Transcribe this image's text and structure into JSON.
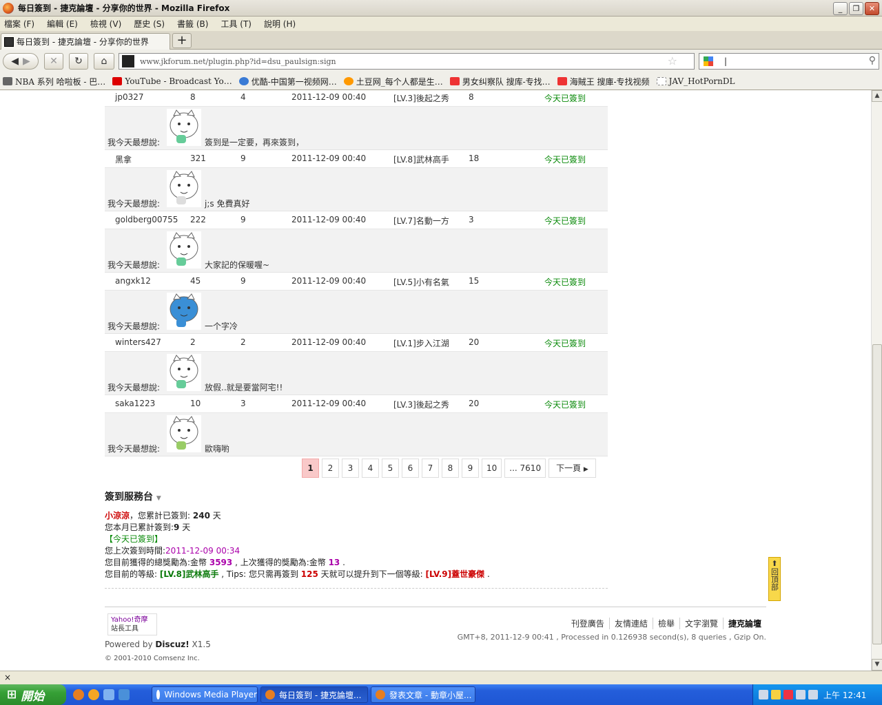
{
  "window": {
    "title": "每日簽到 - 捷克論壇 - 分享你的世界 - Mozilla Firefox"
  },
  "menu": [
    "檔案 (F)",
    "編輯 (E)",
    "檢視 (V)",
    "歷史 (S)",
    "書籤 (B)",
    "工具 (T)",
    "說明 (H)"
  ],
  "tab": {
    "label": "每日簽到 - 捷克論壇 - 分享你的世界",
    "new_tab": "+"
  },
  "nav": {
    "url": "www.jkforum.net/plugin.php?id=dsu_paulsign:sign",
    "search_value": "|"
  },
  "bookmarks": [
    "NBA 系列 哈啦板 - 巴…",
    "YouTube - Broadcast Yo…",
    "优酷-中国第一视频网…",
    "土豆网_每个人都是生…",
    "男女纠察队 搜库-专找…",
    "海賊王 搜庫-专找视频",
    "JAV_HotPornDL"
  ],
  "records": [
    {
      "user": "jp0327",
      "total": "8",
      "month": "4",
      "time": "2011-12-09 00:40",
      "level": "[LV.3]後起之秀",
      "reward": "8",
      "status": "今天已簽到",
      "mood_label": "我今天最想說:",
      "mood": "簽到是一定要，再來簽到，"
    },
    {
      "user": "黑拿",
      "total": "321",
      "month": "9",
      "time": "2011-12-09 00:40",
      "level": "[LV.8]武林高手",
      "reward": "18",
      "status": "今天已簽到",
      "mood_label": "我今天最想說:",
      "mood": "j;s 免費真好"
    },
    {
      "user": "goldberg00755",
      "total": "222",
      "month": "9",
      "time": "2011-12-09 00:40",
      "level": "[LV.7]名動一方",
      "reward": "3",
      "status": "今天已簽到",
      "mood_label": "我今天最想說:",
      "mood": "大家記的保暖喔~"
    },
    {
      "user": "angxk12",
      "total": "45",
      "month": "9",
      "time": "2011-12-09 00:40",
      "level": "[LV.5]小有名氣",
      "reward": "15",
      "status": "今天已簽到",
      "mood_label": "我今天最想說:",
      "mood": "一个字冷"
    },
    {
      "user": "winters427",
      "total": "2",
      "month": "2",
      "time": "2011-12-09 00:40",
      "level": "[LV.1]步入江湖",
      "reward": "20",
      "status": "今天已簽到",
      "mood_label": "我今天最想說:",
      "mood": "放假..就是要當阿宅!!"
    },
    {
      "user": "saka1223",
      "total": "10",
      "month": "3",
      "time": "2011-12-09 00:40",
      "level": "[LV.3]後起之秀",
      "reward": "20",
      "status": "今天已簽到",
      "mood_label": "我今天最想說:",
      "mood": "歐嗨喲"
    }
  ],
  "pager": {
    "pages": [
      "1",
      "2",
      "3",
      "4",
      "5",
      "6",
      "7",
      "8",
      "9",
      "10",
      "... 7610"
    ],
    "current": "1",
    "next": "下一頁"
  },
  "service": {
    "title": "簽到服務台",
    "user": "小涼涼",
    "line1_a": "，您累計已簽到: ",
    "total_days": "240",
    "days_unit": " 天",
    "line2_a": "您本月已累計簽到:",
    "month_days": "9",
    "line3": "【今天已簽到】",
    "line4_a": "您上次簽到時間:",
    "last_time": "2011-12-09 00:34",
    "line5_a": "您目前獲得的總獎勵為:金幣 ",
    "total_reward": "3593",
    "line5_b": " , 上次獲得的獎勵為:金幣 ",
    "last_reward": "13",
    "line5_c": " .",
    "line6_a": "您目前的等級: ",
    "cur_level": "[LV.8]武林高手",
    "line6_b": " , Tips: 您只需再簽到 ",
    "days_needed": "125",
    "line6_c": " 天就可以提升到下一個等級: ",
    "next_level": "[LV.9]蓋世豪傑",
    "line6_d": " ."
  },
  "footer": {
    "yahoo_a": "Yahoo!奇摩",
    "yahoo_b": "站長工具",
    "powered_a": "Powered by ",
    "powered_b": "Discuz!",
    "powered_c": " X1.5",
    "copyright": "© 2001-2010 Comsenz Inc.",
    "links": [
      "刊登廣告",
      "友情連結",
      "檢舉",
      "文字瀏覽",
      "捷克論壇"
    ],
    "stats": "GMT+8, 2011-12-9 00:41 , Processed in 0.126938 second(s), 8 queries , Gzip On.",
    "to_top": "回頂部"
  },
  "statusbar": {
    "text": "×"
  },
  "taskbar": {
    "start": "開始",
    "tasks": [
      "Windows Media Player",
      "每日簽到 - 捷克論壇...",
      "發表文章 - 動章小屋..."
    ],
    "clock": "上午 12:41"
  }
}
